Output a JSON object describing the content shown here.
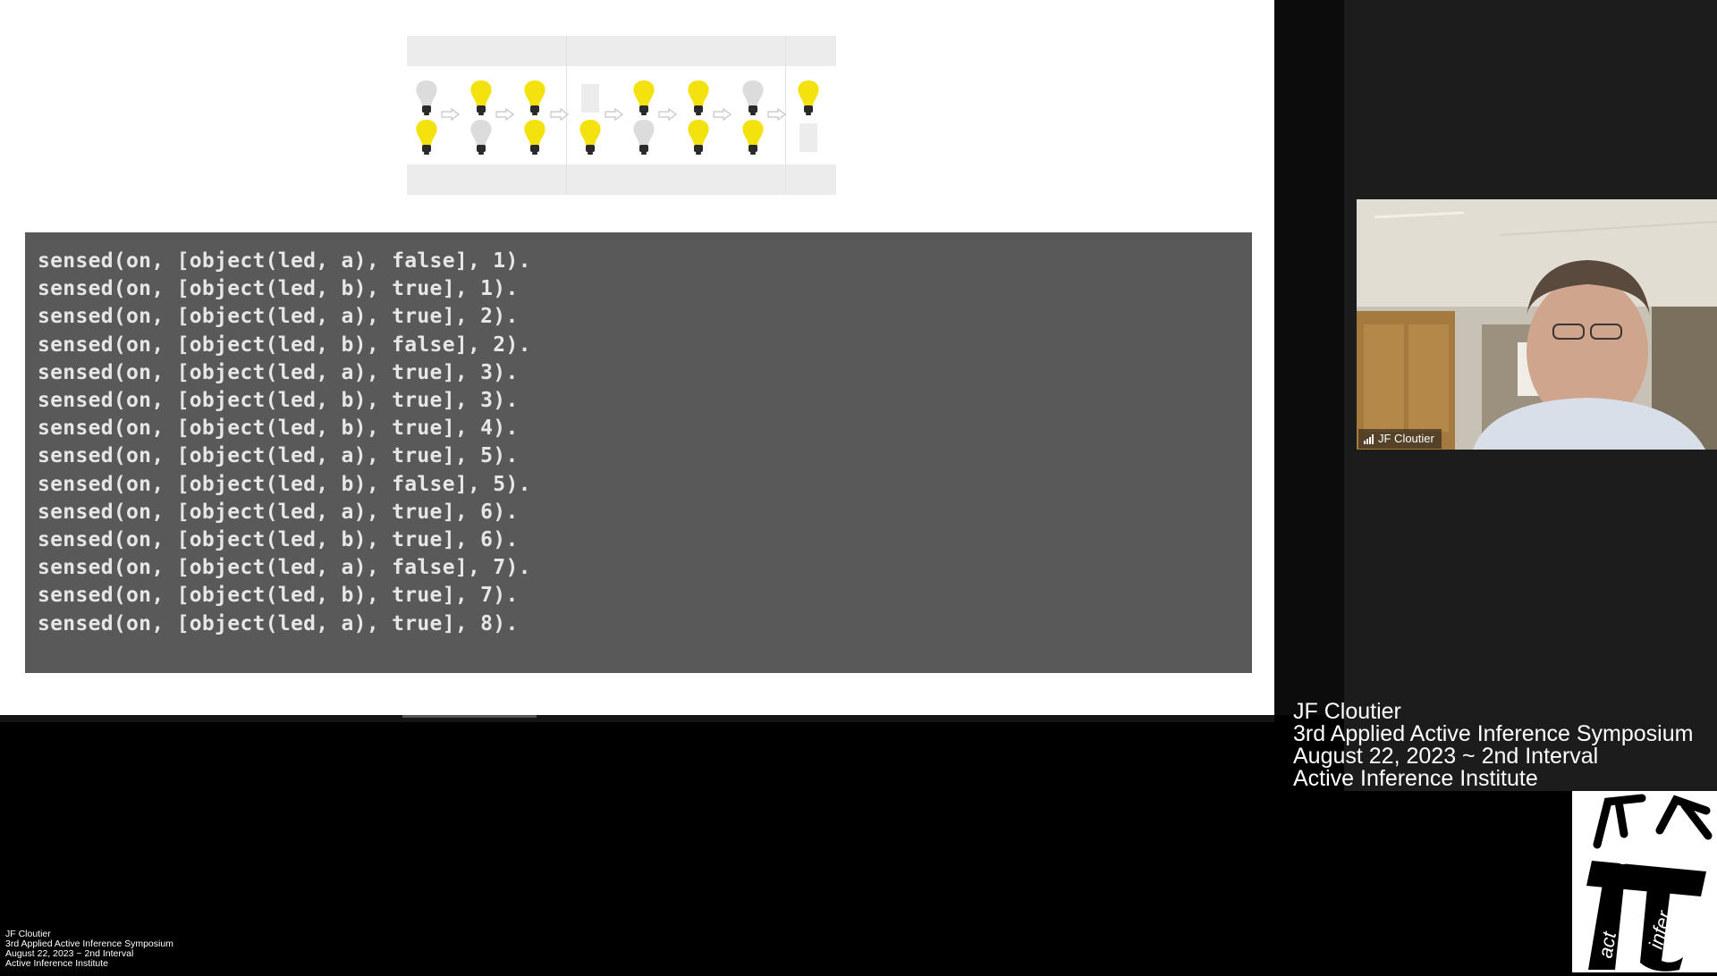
{
  "slide": {
    "diagram": {
      "row_top": [
        "off",
        "on",
        "on",
        "blank",
        "on",
        "on",
        "off",
        "on"
      ],
      "row_bottom": [
        "on",
        "off",
        "on",
        "on",
        "off",
        "on",
        "on",
        "blank"
      ],
      "colors": {
        "on": "#f4e20e",
        "off": "#dcdcdc",
        "base": "#2a2a2a"
      }
    },
    "code_lines": [
      "sensed(on, [object(led, a), false], 1).",
      "sensed(on, [object(led, b), true], 1).",
      "sensed(on, [object(led, a), true], 2).",
      "sensed(on, [object(led, b), false], 2).",
      "sensed(on, [object(led, a), true], 3).",
      "sensed(on, [object(led, b), true], 3).",
      "sensed(on, [object(led, b), true], 4).",
      "sensed(on, [object(led, a), true], 5).",
      "sensed(on, [object(led, b), false], 5).",
      "sensed(on, [object(led, a), true], 6).",
      "sensed(on, [object(led, b), true], 6).",
      "sensed(on, [object(led, a), false], 7).",
      "sensed(on, [object(led, b), true], 7).",
      "sensed(on, [object(led, a), true], 8)."
    ]
  },
  "participant": {
    "name": "JF Cloutier",
    "signal_icon": "signal-bars-icon"
  },
  "caption": {
    "name": "JF Cloutier",
    "event": "3rd Applied Active Inference Symposium",
    "date": "August 22, 2023 ~ 2nd Interval",
    "org": "Active Inference Institute"
  },
  "logo": {
    "word_top": "serve",
    "word_left": "act",
    "word_right": "infer"
  }
}
